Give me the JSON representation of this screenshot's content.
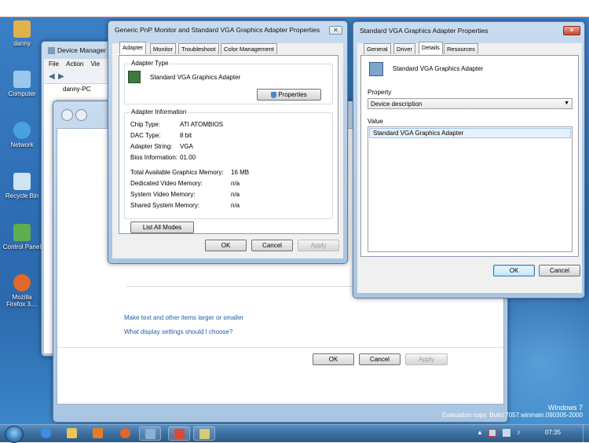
{
  "desktop_icons": [
    {
      "id": "danny",
      "label": "danny",
      "color": "#e0b24a"
    },
    {
      "id": "computer",
      "label": "Computer",
      "color": "#9cc6ee"
    },
    {
      "id": "network",
      "label": "Network",
      "color": "#4aa0e0"
    },
    {
      "id": "recycle",
      "label": "Recycle Bin",
      "color": "#cfe3f3"
    },
    {
      "id": "control",
      "label": "Control Panel",
      "color": "#5fae4f"
    },
    {
      "id": "firefox",
      "label_line1": "Mozilla",
      "label_line2": "Firefox 3....",
      "color": "#e2672a"
    }
  ],
  "device_manager": {
    "title": "Device Manager",
    "menu": [
      "File",
      "Action",
      "Vie"
    ],
    "tree_item": "danny-PC"
  },
  "display_settings": {
    "links": [
      "Make text and other items larger or smaller",
      "What display settings should I choose?"
    ],
    "ok": "OK",
    "cancel": "Cancel",
    "apply": "Apply"
  },
  "monitor_props": {
    "title": "Generic PnP Monitor and Standard VGA Graphics Adapter Properties",
    "tabs": [
      "Adapter",
      "Monitor",
      "Troubleshoot",
      "Color Management"
    ],
    "adapter_type_label": "Adapter Type",
    "adapter_name": "Standard VGA Graphics Adapter",
    "properties_button": "Properties",
    "adapter_info_label": "Adapter Information",
    "info": [
      {
        "k": "Chip Type:",
        "v": "ATI ATOMBIOS"
      },
      {
        "k": "DAC Type:",
        "v": "8 bit"
      },
      {
        "k": "Adapter String:",
        "v": "VGA"
      },
      {
        "k": "Bios Information:",
        "v": "01.00"
      }
    ],
    "memory": [
      {
        "k": "Total Available Graphics Memory:",
        "v": "16 MB"
      },
      {
        "k": "Dedicated Video Memory:",
        "v": "n/a"
      },
      {
        "k": "System Video Memory:",
        "v": "n/a"
      },
      {
        "k": "Shared System Memory:",
        "v": "n/a"
      }
    ],
    "list_all_modes": "List All Modes",
    "ok": "OK",
    "cancel": "Cancel",
    "apply": "Apply"
  },
  "vga_props": {
    "title": "Standard VGA Graphics Adapter Properties",
    "tabs": [
      "General",
      "Driver",
      "Details",
      "Resources"
    ],
    "device_name": "Standard VGA Graphics Adapter",
    "property_label": "Property",
    "property_value": "Device description",
    "value_label": "Value",
    "value_item": "Standard VGA Graphics Adapter",
    "ok": "OK",
    "cancel": "Cancel"
  },
  "watermark": {
    "line1": "Windows 7",
    "line2": "Evaluation copy. Build 7057.winmain.090305-2000"
  },
  "taskbar": {
    "clock": "07:35"
  }
}
